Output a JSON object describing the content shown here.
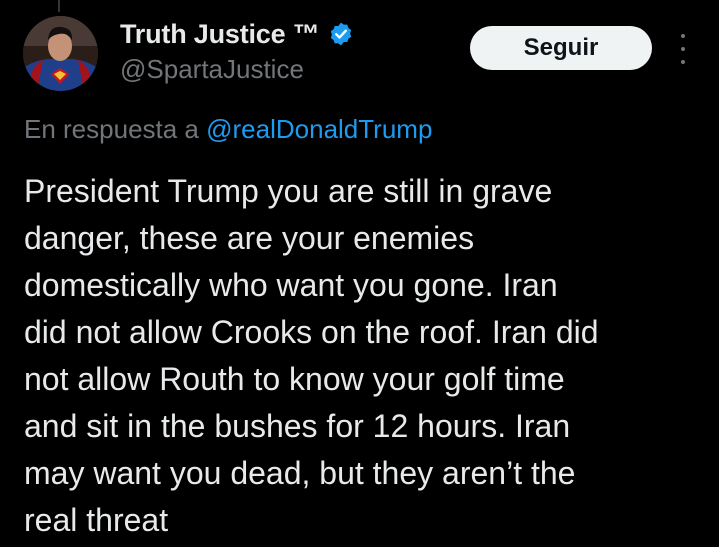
{
  "author": {
    "display_name": "Truth Justice ™",
    "handle": "@SpartaJustice",
    "verified": true,
    "avatar_icon": "superman-avatar"
  },
  "actions": {
    "follow_label": "Seguir",
    "more_icon": "more-vertical-icon"
  },
  "reply": {
    "prefix": "En respuesta a ",
    "mention": "@realDonaldTrump"
  },
  "tweet": {
    "text": "President Trump you are still in grave\ndanger, these are your enemies\ndomestically who want you gone. Iran\ndid not allow Crooks on the roof. Iran did\nnot allow Routh to know your golf time\nand sit in the bushes for 12 hours. Iran\nmay want you dead, but they aren’t the\nreal threat"
  },
  "colors": {
    "background": "#000000",
    "text_primary": "#e7e9ea",
    "text_secondary": "#71767b",
    "accent": "#1d9bf0",
    "button_bg": "#eff3f4"
  }
}
